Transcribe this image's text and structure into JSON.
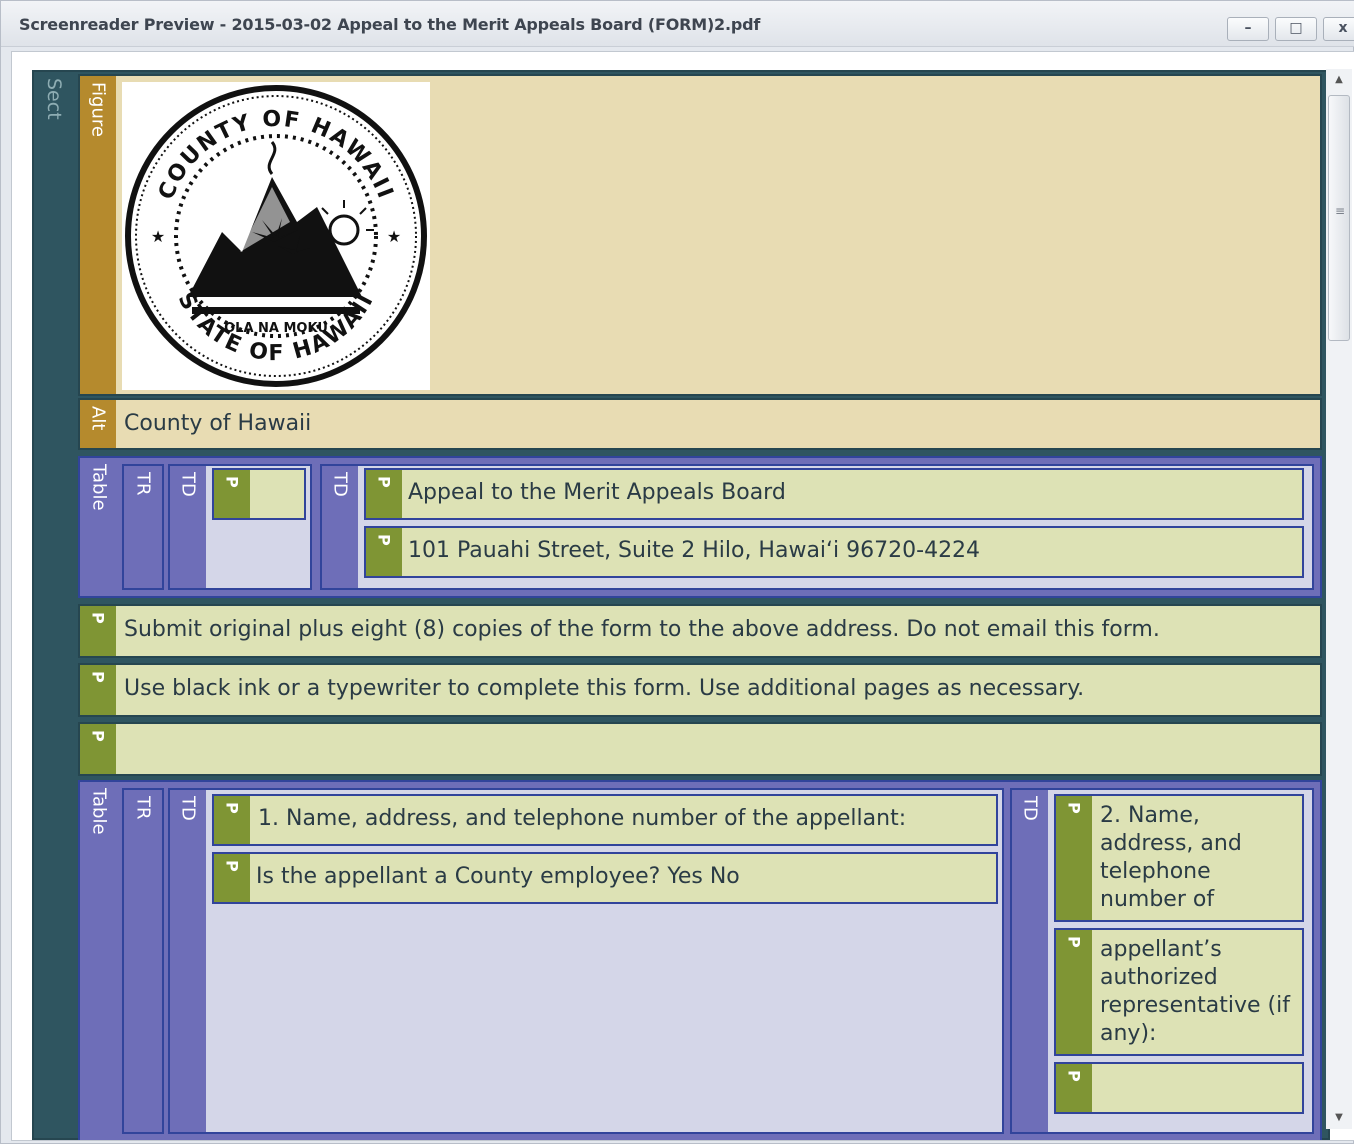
{
  "window": {
    "title": "Screenreader Preview - 2015-03-02 Appeal to the Merit Appeals Board (FORM)2.pdf",
    "min_glyph": "–",
    "max_glyph": "□",
    "close_glyph": "x"
  },
  "scrollbar": {
    "up_glyph": "▲",
    "down_glyph": "▼",
    "grip_glyph": "≡"
  },
  "tags": {
    "sect": "Sect",
    "figure": "Figure",
    "alt": "Alt",
    "table": "Table",
    "tr": "TR",
    "td": "TD",
    "p": "P"
  },
  "figure": {
    "seal_top_text": "COUNTY OF HAWAII",
    "seal_middle_text": "OLA NA MOKU",
    "seal_bottom_text": "STATE OF HAWAII"
  },
  "alt_text": "County of Hawaii",
  "table1": {
    "td2": {
      "p1": "Appeal to the Merit Appeals Board",
      "p2": "101 Pauahi Street, Suite 2 Hilo, Hawaiʻi 96720-4224"
    }
  },
  "paragraphs": {
    "p1": "Submit original plus eight (8) copies of the form to the above address. Do not email this form.",
    "p2": "Use black ink or a typewriter to complete this form. Use additional pages as necessary.",
    "p3": ""
  },
  "table2": {
    "td1": {
      "p1": "1. Name, address, and telephone number of the appellant:",
      "p2": "Is the appellant a County employee? Yes No"
    },
    "td2": {
      "p1": "2. Name, address, and telephone number of",
      "p2": "appellant’s authorized representative (if any):",
      "p3": ""
    }
  },
  "colors": {
    "sect": "#2f5560",
    "figure_tag": "#b58a2d",
    "figure_bg": "#e8dcb3",
    "table": "#6e6eb8",
    "table_border": "#31449b",
    "td_bg": "#d4d6e8",
    "p_tag": "#7f9534",
    "p_bg": "#dde2b5"
  }
}
